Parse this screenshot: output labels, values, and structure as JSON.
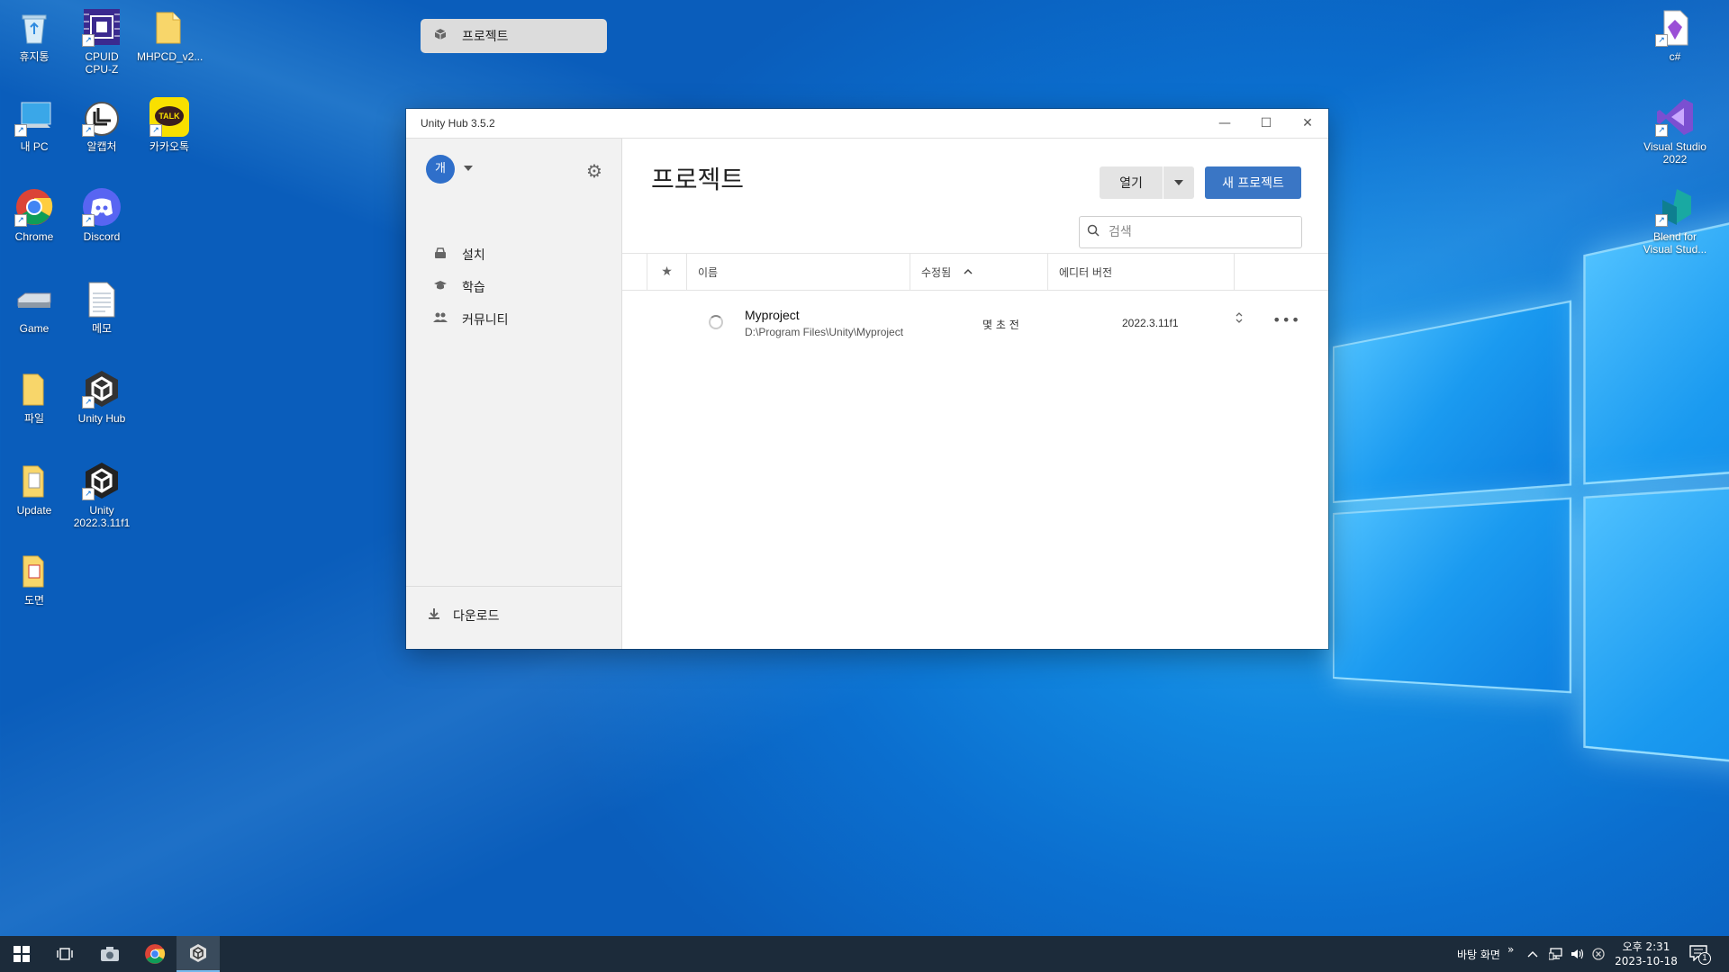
{
  "desktop": {
    "left_icons": [
      {
        "label": "휴지통",
        "icon": "recycle-bin-icon"
      },
      {
        "label": "CPUID\nCPU-Z",
        "icon": "cpuz-icon"
      },
      {
        "label": "MHPCD_v2...",
        "icon": "folder-icon"
      },
      {
        "label": "내 PC",
        "icon": "this-pc-icon"
      },
      {
        "label": "알캡처",
        "icon": "alcapture-icon"
      },
      {
        "label": "카카오톡",
        "icon": "kakaotalk-icon"
      },
      {
        "label": "Chrome",
        "icon": "chrome-icon"
      },
      {
        "label": "Discord",
        "icon": "discord-icon"
      },
      {
        "label": "Game",
        "icon": "drive-icon"
      },
      {
        "label": "메모",
        "icon": "text-file-icon"
      },
      {
        "label": "파일",
        "icon": "folder-icon"
      },
      {
        "label": "Unity Hub",
        "icon": "unity-hub-icon"
      },
      {
        "label": "Update",
        "icon": "folder-icon"
      },
      {
        "label": "Unity\n2022.3.11f1",
        "icon": "unity-icon"
      },
      {
        "label": "도면",
        "icon": "folder-icon"
      }
    ],
    "right_icons": [
      {
        "label": "c#",
        "icon": "csharp-file-icon"
      },
      {
        "label": "Visual Studio\n2022",
        "icon": "visual-studio-icon"
      },
      {
        "label": "Blend for\nVisual Stud...",
        "icon": "blend-icon"
      }
    ],
    "kakao_badge": "TALK"
  },
  "window": {
    "title": "Unity Hub 3.5.2",
    "controls": {
      "minimize": "—",
      "maximize": "☐",
      "close": "✕"
    }
  },
  "sidebar": {
    "avatar_initial": "개",
    "nav": [
      {
        "label": "프로젝트",
        "icon": "cube-icon",
        "active": true
      },
      {
        "label": "설치",
        "icon": "installs-icon",
        "active": false
      },
      {
        "label": "학습",
        "icon": "learn-icon",
        "active": false
      },
      {
        "label": "커뮤니티",
        "icon": "community-icon",
        "active": false
      }
    ],
    "downloads_label": "다운로드"
  },
  "main": {
    "heading": "프로젝트",
    "open_label": "열기",
    "new_project_label": "새 프로젝트",
    "search_placeholder": "검색",
    "columns": {
      "star": "★",
      "name": "이름",
      "modified": "수정됨",
      "editor_version": "에디터 버전"
    },
    "projects": [
      {
        "name": "Myproject",
        "path": "D:\\Program Files\\Unity\\Myproject",
        "modified": "몇 초 전",
        "editor_version": "2022.3.11f1"
      }
    ]
  },
  "taskbar": {
    "desktop_label": "바탕 화면",
    "chevron": "»",
    "time": "오후 2:31",
    "date": "2023-10-18",
    "notification_count": "1"
  },
  "colors": {
    "accent": "#3a76c5",
    "taskbar": "#1c2b3a",
    "avatar": "#2f6fca"
  }
}
